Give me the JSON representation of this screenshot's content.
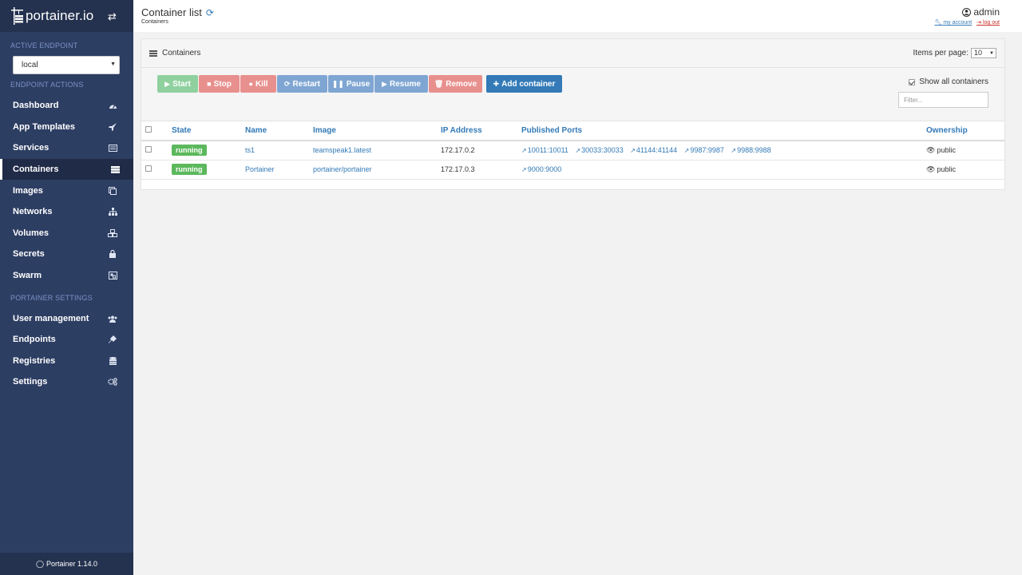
{
  "sidebar": {
    "brand": "portainer.io",
    "active_endpoint_title": "ACTIVE ENDPOINT",
    "endpoint_value": "local",
    "endpoint_actions_title": "ENDPOINT ACTIONS",
    "items": [
      {
        "label": "Dashboard",
        "icon": "tachometer-icon"
      },
      {
        "label": "App Templates",
        "icon": "rocket-icon"
      },
      {
        "label": "Services",
        "icon": "list-alt-icon"
      },
      {
        "label": "Containers",
        "icon": "server-icon"
      },
      {
        "label": "Images",
        "icon": "clone-icon"
      },
      {
        "label": "Networks",
        "icon": "sitemap-icon"
      },
      {
        "label": "Volumes",
        "icon": "cubes-icon"
      },
      {
        "label": "Secrets",
        "icon": "lock-icon"
      },
      {
        "label": "Swarm",
        "icon": "object-group-icon"
      }
    ],
    "settings_title": "PORTAINER SETTINGS",
    "settings_items": [
      {
        "label": "User management",
        "icon": "users-icon"
      },
      {
        "label": "Endpoints",
        "icon": "plug-icon"
      },
      {
        "label": "Registries",
        "icon": "database-icon"
      },
      {
        "label": "Settings",
        "icon": "cogs-icon"
      }
    ],
    "footer": "Portainer 1.14.0"
  },
  "header": {
    "title": "Container list",
    "breadcrumb": "Containers",
    "user": "admin",
    "my_account": "my account",
    "log_out": "log out"
  },
  "widget": {
    "title": "Containers",
    "items_per_page_label": "Items per page:",
    "items_per_page_value": "10",
    "buttons": {
      "start": "Start",
      "stop": "Stop",
      "kill": "Kill",
      "restart": "Restart",
      "pause": "Pause",
      "resume": "Resume",
      "remove": "Remove",
      "add": "Add container"
    },
    "show_all_label": "Show all containers",
    "filter_placeholder": "Filter...",
    "columns": [
      "State",
      "Name",
      "Image",
      "IP Address",
      "Published Ports",
      "Ownership"
    ],
    "rows": [
      {
        "state": "running",
        "name": "ts1",
        "image": "teamspeak1.latest",
        "ip": "172.17.0.2",
        "ports": [
          "10011:10011",
          "30033:30033",
          "41144:41144",
          "9987:9987",
          "9988:9988"
        ],
        "ownership": "public"
      },
      {
        "state": "running",
        "name": "Portainer",
        "image": "portainer/portainer",
        "ip": "172.17.0.3",
        "ports": [
          "9000:9000"
        ],
        "ownership": "public"
      }
    ]
  },
  "colors": {
    "sidebar_bg": "#2d3e63",
    "sidebar_dark": "#24324f",
    "link": "#337ab7",
    "success": "#5cb85c",
    "danger": "#d9534f"
  }
}
